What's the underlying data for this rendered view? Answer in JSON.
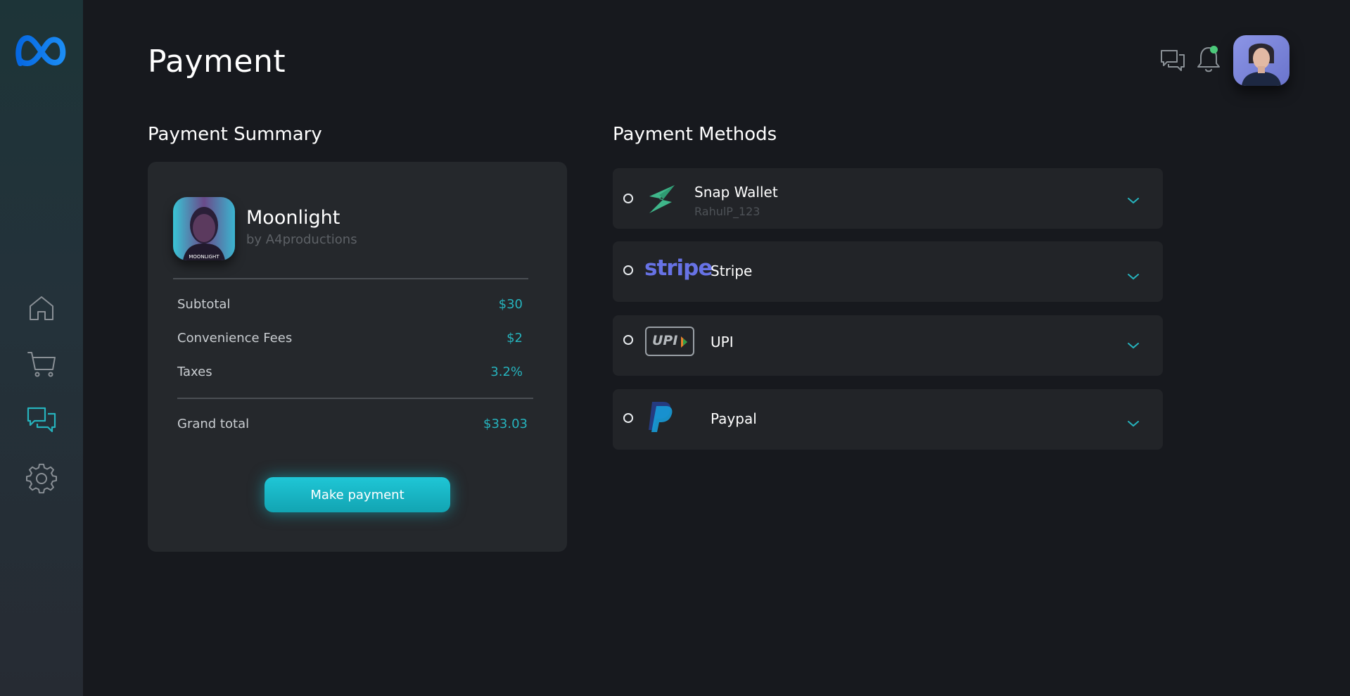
{
  "page": {
    "title": "Payment"
  },
  "sidebar": {
    "logo": "meta-infinity-logo",
    "items": [
      {
        "icon": "home-icon"
      },
      {
        "icon": "cart-icon"
      },
      {
        "icon": "chat-icon",
        "active": true
      },
      {
        "icon": "gear-icon"
      }
    ]
  },
  "header": {
    "icons": [
      "messages-icon",
      "bell-icon"
    ],
    "notification_dot_color": "#4bc97a"
  },
  "summary": {
    "heading": "Payment Summary",
    "product": {
      "name": "Moonlight",
      "by": "by A4productions",
      "art_caption": "MOONLIGHT"
    },
    "rows": [
      {
        "label": "Subtotal",
        "value": "$30"
      },
      {
        "label": "Convenience Fees",
        "value": "$2"
      },
      {
        "label": "Taxes",
        "value": "3.2%"
      }
    ],
    "total": {
      "label": "Grand total",
      "value": "$33.03"
    },
    "button_label": "Make payment"
  },
  "methods": {
    "heading": "Payment Methods",
    "items": [
      {
        "name": "Snap Wallet",
        "sub": "RahulP_123",
        "logo": "snap-wallet-logo"
      },
      {
        "name": "Stripe",
        "logo": "stripe-logo",
        "logo_text": "stripe"
      },
      {
        "name": "UPI",
        "logo": "upi-logo",
        "logo_text": "UPI"
      },
      {
        "name": "Paypal",
        "logo": "paypal-logo"
      }
    ]
  },
  "colors": {
    "accent": "#26b3bd",
    "button": "#18b8c8",
    "background": "#17191e",
    "card": "#25282c",
    "method_row": "#222428"
  }
}
